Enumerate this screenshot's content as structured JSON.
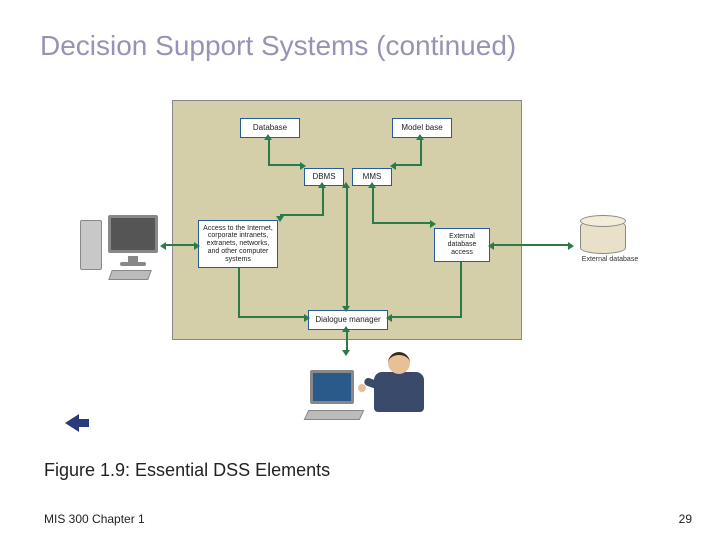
{
  "title": "Decision Support Systems (continued)",
  "caption": "Figure 1.9: Essential DSS Elements",
  "footer": "MIS 300 Chapter 1",
  "page": "29",
  "diagram": {
    "database": "Database",
    "modelbase": "Model base",
    "dbms": "DBMS",
    "mms": "MMS",
    "access": "Access to the Internet, corporate intranets, extranets, networks, and other computer systems",
    "extdbacc": "External database access",
    "dialogue": "Dialogue manager",
    "extdb": "External database"
  }
}
